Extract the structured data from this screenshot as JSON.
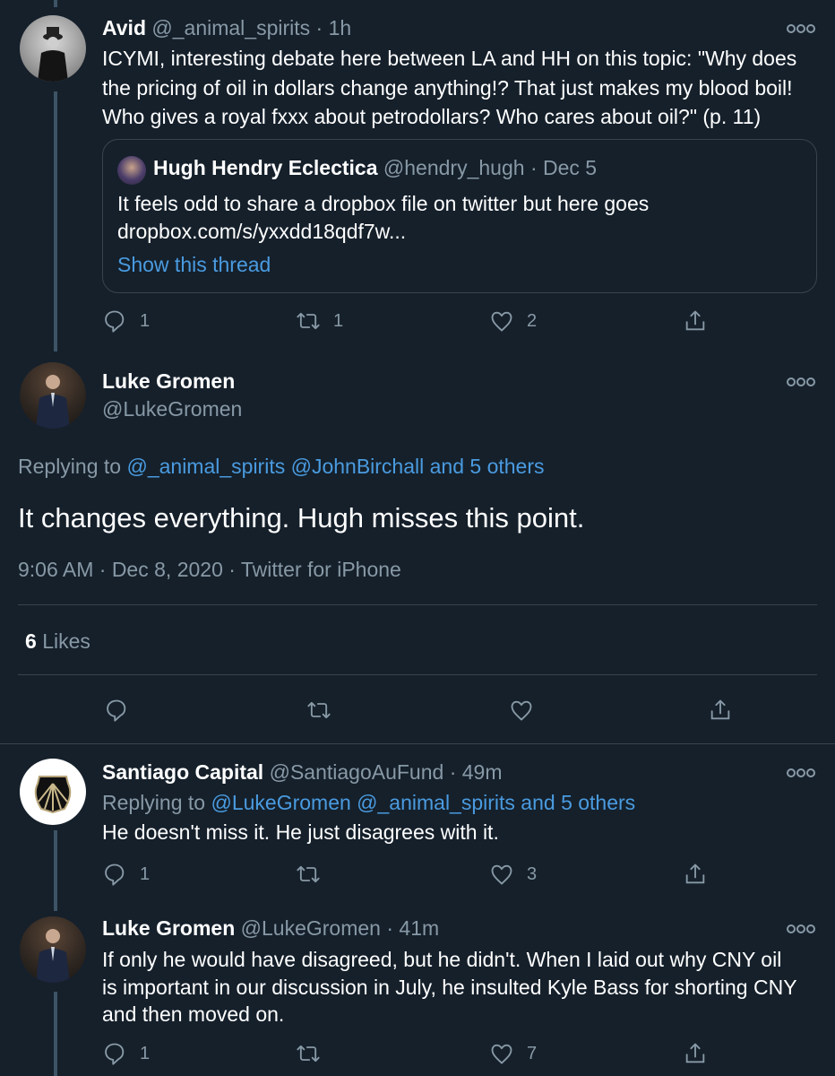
{
  "tweet_avid": {
    "name": "Avid",
    "handle": "@_animal_spirits",
    "time": "· 1h",
    "lines": [
      "ICYMI, interesting debate here between LA and HH on this topic: \"Why does",
      "the pricing of oil in dollars change anything!? That just makes my blood boil!",
      "Who gives a royal fxxx about petrodollars? Who cares about oil?\" (p. 11)"
    ],
    "quote": {
      "name": "Hugh Hendry Eclectica",
      "handle": "@hendry_hugh",
      "time": "· Dec 5",
      "line1": "It feels odd to share a dropbox file on twitter but here goes",
      "line2": "dropbox.com/s/yxxdd18qdf7w...",
      "show_thread": "Show this thread"
    },
    "counts": {
      "reply": "1",
      "retweet": "1",
      "like": "2"
    }
  },
  "main_tweet": {
    "name": "Luke Gromen",
    "handle": "@LukeGromen",
    "replying_label": "Replying to",
    "replying_links": "@_animal_spirits @JohnBirchall and 5 others",
    "text": "It changes everything.  Hugh misses this point.",
    "meta": "9:06 AM · Dec 8, 2020 · Twitter for iPhone",
    "likes_count": "6",
    "likes_label": "Likes"
  },
  "tweet_santiago": {
    "name": "Santiago Capital",
    "handle": "@SantiagoAuFund",
    "time": "· 49m",
    "replying_label": "Replying to",
    "replying_links": "@LukeGromen @_animal_spirits and 5 others",
    "text": "He doesn't miss it.  He just disagrees with it.",
    "counts": {
      "reply": "1",
      "retweet": "",
      "like": "3"
    }
  },
  "tweet_luke2": {
    "name": "Luke Gromen",
    "handle": "@LukeGromen",
    "time": "· 41m",
    "lines": [
      "If only he would have disagreed, but he didn't.  When I laid out why CNY oil",
      "is important in our discussion in July, he insulted Kyle Bass for shorting CNY",
      "and then moved on."
    ],
    "counts": {
      "reply": "1",
      "retweet": "",
      "like": "7"
    }
  }
}
